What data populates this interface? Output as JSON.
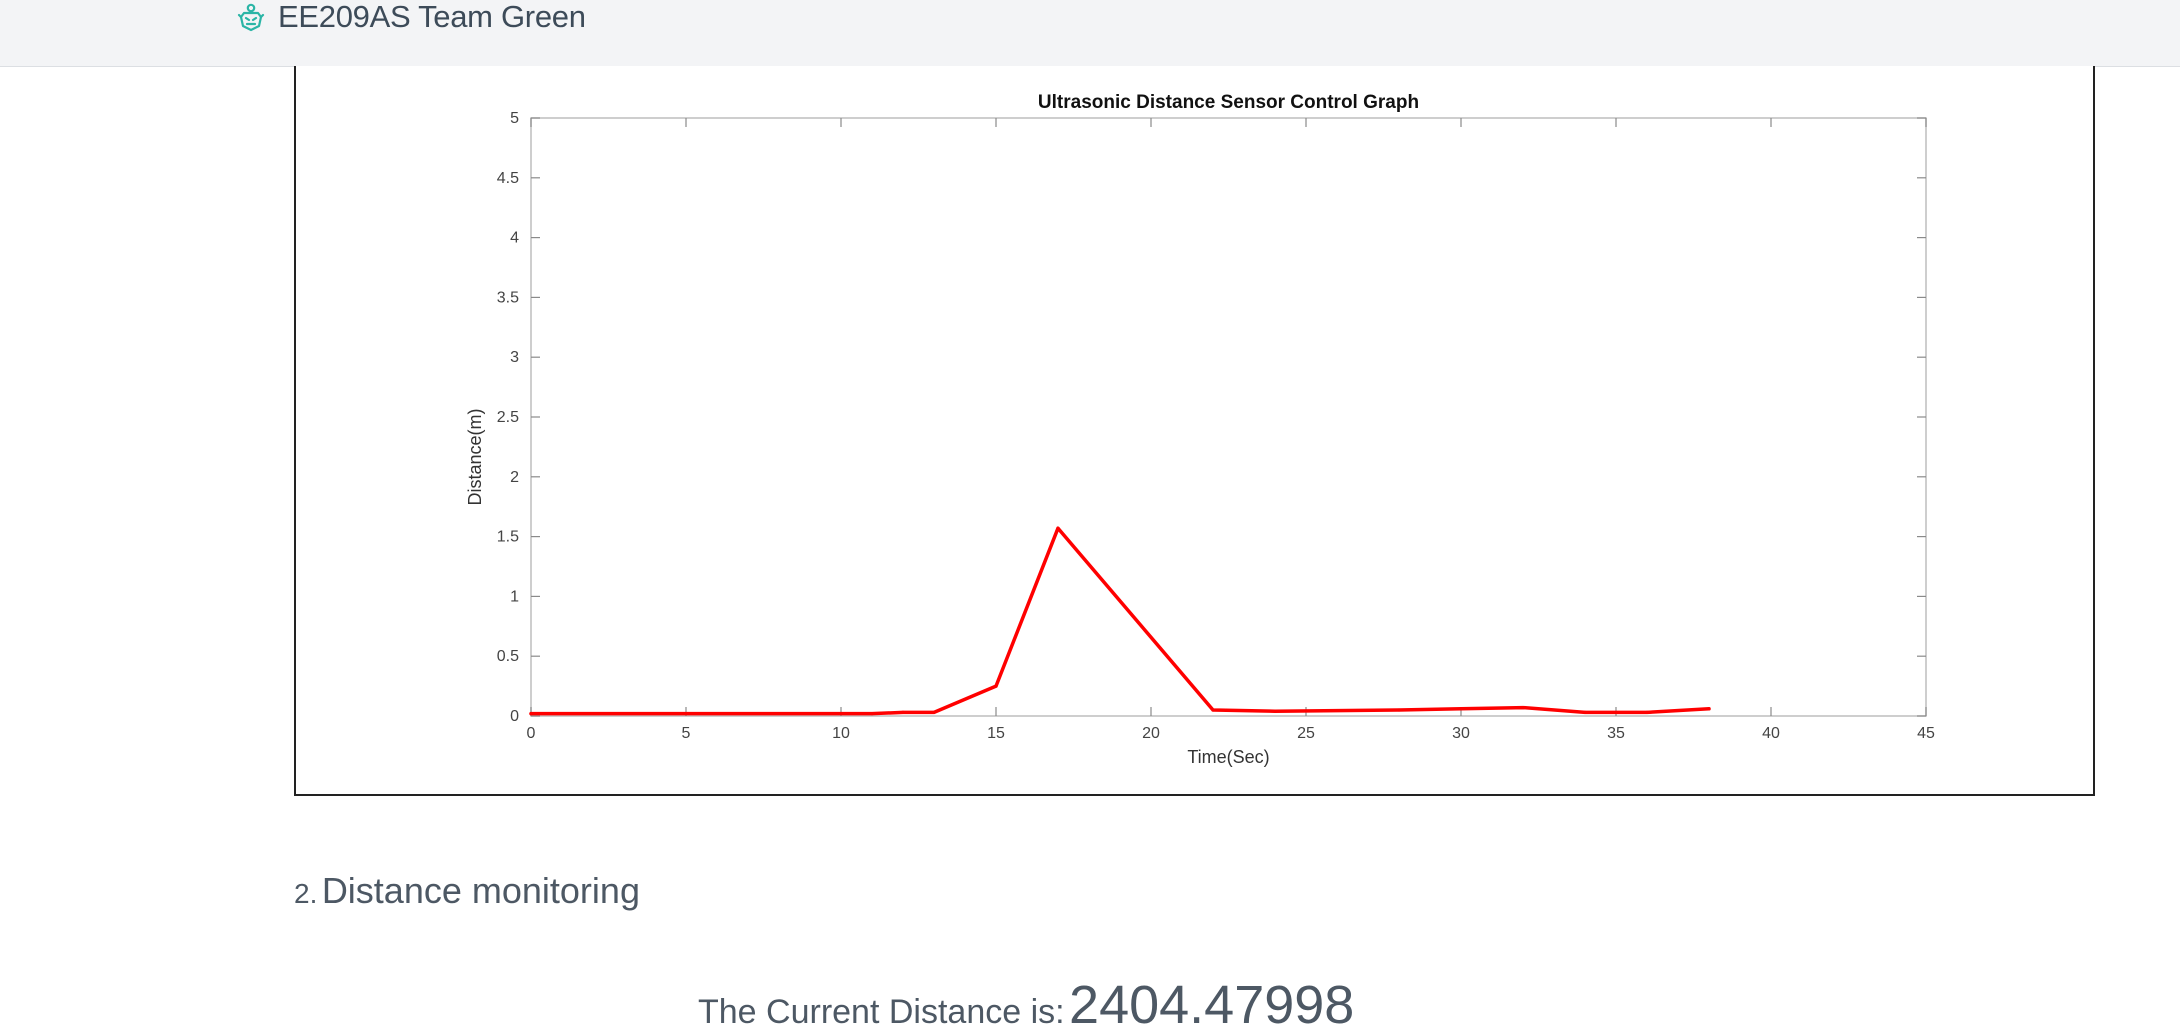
{
  "header": {
    "site_title": "EE209AS Team Green",
    "brand_icon": "robot-head-icon",
    "brand_color": "#2bb5a6"
  },
  "section": {
    "number": "2.",
    "title": "Distance monitoring"
  },
  "current_distance": {
    "label": "The Current Distance is:",
    "value": "2404.47998"
  },
  "chart_data": {
    "type": "line",
    "title": "Ultrasonic Distance Sensor Control Graph",
    "xlabel": "Time(Sec)",
    "ylabel": "Distance(m)",
    "xlim": [
      0,
      45
    ],
    "ylim": [
      0,
      5
    ],
    "xticks": [
      "0",
      "5",
      "10",
      "15",
      "20",
      "25",
      "30",
      "35",
      "40",
      "45"
    ],
    "yticks": [
      "0",
      "0.5",
      "1",
      "1.5",
      "2",
      "2.5",
      "3",
      "3.5",
      "4",
      "4.5",
      "5"
    ],
    "grid": false,
    "series": [
      {
        "color": "#ff0000",
        "x": [
          0,
          11,
          12,
          13,
          15,
          17,
          22,
          24,
          28,
          30,
          32,
          34,
          36,
          38
        ],
        "y": [
          0.02,
          0.02,
          0.03,
          0.03,
          0.25,
          1.57,
          0.05,
          0.04,
          0.05,
          0.06,
          0.07,
          0.03,
          0.03,
          0.06
        ]
      }
    ]
  }
}
